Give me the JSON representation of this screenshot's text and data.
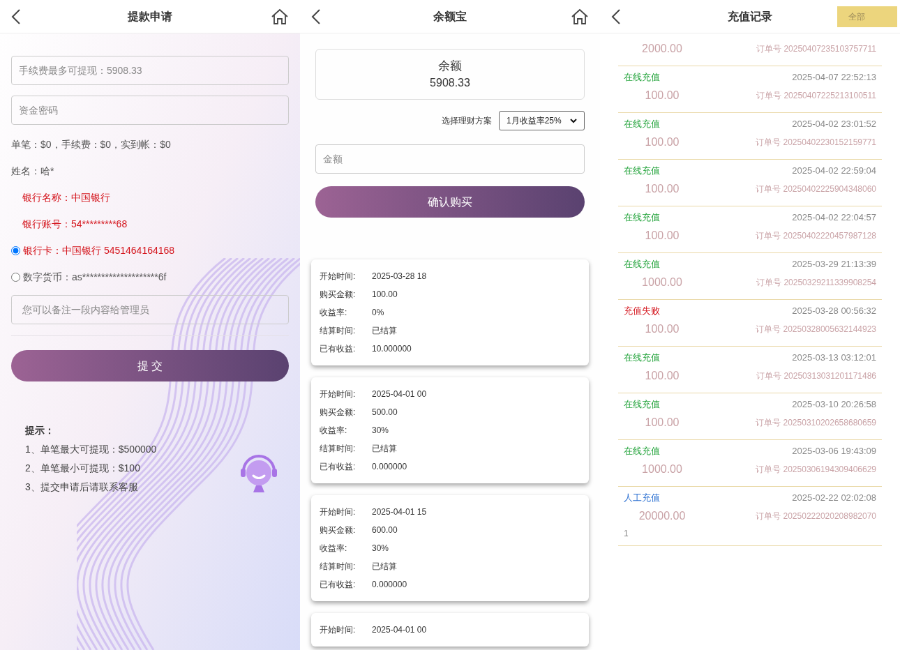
{
  "withdraw": {
    "title": "提款申请",
    "amount_field": {
      "placeholder": "手续费最多可提现：5908.33"
    },
    "password_field": {
      "placeholder": "资金密码"
    },
    "summary": "单笔：$0，手续费：$0，实到帐：$0",
    "name": "姓名：哈*",
    "bank_name": "银行名称：中国银行",
    "bank_account": "银行账号：54*********68",
    "options": [
      {
        "label": "银行卡：中国银行 5451464164168",
        "selected": true
      },
      {
        "label": "数字货币：as********************6f",
        "selected": false
      }
    ],
    "remark_field": {
      "placeholder": "您可以备注一段内容给管理员"
    },
    "submit": "提 交",
    "tips_title": "提示：",
    "tips": [
      "1、单笔最大可提现：$500000",
      "2、单笔最小可提现：$100",
      "3、提交申请后请联系客服"
    ]
  },
  "balance": {
    "title": "余额宝",
    "balance_label": "余额",
    "balance_value": "5908.33",
    "plan_label": "选择理财方案",
    "plan_value": "1月收益率25%",
    "amount_field": {
      "placeholder": "金额"
    },
    "confirm": "确认购买",
    "orders": [
      {
        "rows": [
          {
            "label": "开始时间:",
            "value": "2025-03-28 18"
          },
          {
            "label": "购买金额:",
            "value": "100.00"
          },
          {
            "label": "收益率:",
            "value": "0%"
          },
          {
            "label": "结算时间:",
            "value": "已结算"
          },
          {
            "label": "已有收益:",
            "value": "10.000000"
          }
        ]
      },
      {
        "rows": [
          {
            "label": "开始时间:",
            "value": "2025-04-01 00"
          },
          {
            "label": "购买金额:",
            "value": "500.00"
          },
          {
            "label": "收益率:",
            "value": "30%"
          },
          {
            "label": "结算时间:",
            "value": "已结算"
          },
          {
            "label": "已有收益:",
            "value": "0.000000"
          }
        ]
      },
      {
        "rows": [
          {
            "label": "开始时间:",
            "value": "2025-04-01 15"
          },
          {
            "label": "购买金额:",
            "value": "600.00"
          },
          {
            "label": "收益率:",
            "value": "30%"
          },
          {
            "label": "结算时间:",
            "value": "已结算"
          },
          {
            "label": "已有收益:",
            "value": "0.000000"
          }
        ]
      },
      {
        "rows": [
          {
            "label": "开始时间:",
            "value": "2025-04-01 00"
          }
        ]
      }
    ]
  },
  "recharge": {
    "title": "充值记录",
    "filter": "全部",
    "records": [
      {
        "amount": "2000.00",
        "order": "订单号 20250407235103757711"
      },
      {
        "status": "在线充值",
        "color": "#22a33a",
        "time": "2025-04-07 22:52:13",
        "amount": "100.00",
        "order": "订单号 20250407225213100511"
      },
      {
        "status": "在线充值",
        "color": "#22a33a",
        "time": "2025-04-02 23:01:52",
        "amount": "100.00",
        "order": "订单号 20250402230152159771"
      },
      {
        "status": "在线充值",
        "color": "#22a33a",
        "time": "2025-04-02 22:59:04",
        "amount": "100.00",
        "order": "订单号 20250402225904348060"
      },
      {
        "status": "在线充值",
        "color": "#22a33a",
        "time": "2025-04-02 22:04:57",
        "amount": "100.00",
        "order": "订单号 20250402220457987128"
      },
      {
        "status": "在线充值",
        "color": "#22a33a",
        "time": "2025-03-29 21:13:39",
        "amount": "1000.00",
        "order": "订单号 20250329211339908254"
      },
      {
        "status": "充值失败",
        "color": "#d4141c",
        "time": "2025-03-28 00:56:32",
        "amount": "100.00",
        "order": "订单号 20250328005632144923"
      },
      {
        "status": "在线充值",
        "color": "#22a33a",
        "time": "2025-03-13 03:12:01",
        "amount": "100.00",
        "order": "订单号 20250313031201171486"
      },
      {
        "status": "在线充值",
        "color": "#22a33a",
        "time": "2025-03-10 20:26:58",
        "amount": "100.00",
        "order": "订单号 20250310202658680659"
      },
      {
        "status": "在线充值",
        "color": "#22a33a",
        "time": "2025-03-06 19:43:09",
        "amount": "1000.00",
        "order": "订单号 20250306194309406629"
      },
      {
        "status": "人工充值",
        "color": "#2a6fd1",
        "time": "2025-02-22 02:02:08",
        "amount": "20000.00",
        "order": "订单号 20250222020208982070",
        "note": "1"
      }
    ]
  }
}
